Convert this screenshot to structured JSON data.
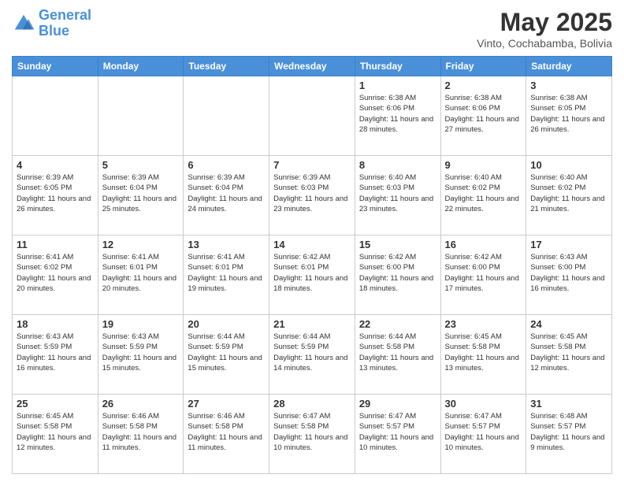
{
  "header": {
    "logo_line1": "General",
    "logo_line2": "Blue",
    "month_year": "May 2025",
    "location": "Vinto, Cochabamba, Bolivia"
  },
  "days_of_week": [
    "Sunday",
    "Monday",
    "Tuesday",
    "Wednesday",
    "Thursday",
    "Friday",
    "Saturday"
  ],
  "weeks": [
    [
      {
        "day": "",
        "sunrise": "",
        "sunset": "",
        "daylight": ""
      },
      {
        "day": "",
        "sunrise": "",
        "sunset": "",
        "daylight": ""
      },
      {
        "day": "",
        "sunrise": "",
        "sunset": "",
        "daylight": ""
      },
      {
        "day": "",
        "sunrise": "",
        "sunset": "",
        "daylight": ""
      },
      {
        "day": "1",
        "sunrise": "Sunrise: 6:38 AM",
        "sunset": "Sunset: 6:06 PM",
        "daylight": "Daylight: 11 hours and 28 minutes."
      },
      {
        "day": "2",
        "sunrise": "Sunrise: 6:38 AM",
        "sunset": "Sunset: 6:06 PM",
        "daylight": "Daylight: 11 hours and 27 minutes."
      },
      {
        "day": "3",
        "sunrise": "Sunrise: 6:38 AM",
        "sunset": "Sunset: 6:05 PM",
        "daylight": "Daylight: 11 hours and 26 minutes."
      }
    ],
    [
      {
        "day": "4",
        "sunrise": "Sunrise: 6:39 AM",
        "sunset": "Sunset: 6:05 PM",
        "daylight": "Daylight: 11 hours and 26 minutes."
      },
      {
        "day": "5",
        "sunrise": "Sunrise: 6:39 AM",
        "sunset": "Sunset: 6:04 PM",
        "daylight": "Daylight: 11 hours and 25 minutes."
      },
      {
        "day": "6",
        "sunrise": "Sunrise: 6:39 AM",
        "sunset": "Sunset: 6:04 PM",
        "daylight": "Daylight: 11 hours and 24 minutes."
      },
      {
        "day": "7",
        "sunrise": "Sunrise: 6:39 AM",
        "sunset": "Sunset: 6:03 PM",
        "daylight": "Daylight: 11 hours and 23 minutes."
      },
      {
        "day": "8",
        "sunrise": "Sunrise: 6:40 AM",
        "sunset": "Sunset: 6:03 PM",
        "daylight": "Daylight: 11 hours and 23 minutes."
      },
      {
        "day": "9",
        "sunrise": "Sunrise: 6:40 AM",
        "sunset": "Sunset: 6:02 PM",
        "daylight": "Daylight: 11 hours and 22 minutes."
      },
      {
        "day": "10",
        "sunrise": "Sunrise: 6:40 AM",
        "sunset": "Sunset: 6:02 PM",
        "daylight": "Daylight: 11 hours and 21 minutes."
      }
    ],
    [
      {
        "day": "11",
        "sunrise": "Sunrise: 6:41 AM",
        "sunset": "Sunset: 6:02 PM",
        "daylight": "Daylight: 11 hours and 20 minutes."
      },
      {
        "day": "12",
        "sunrise": "Sunrise: 6:41 AM",
        "sunset": "Sunset: 6:01 PM",
        "daylight": "Daylight: 11 hours and 20 minutes."
      },
      {
        "day": "13",
        "sunrise": "Sunrise: 6:41 AM",
        "sunset": "Sunset: 6:01 PM",
        "daylight": "Daylight: 11 hours and 19 minutes."
      },
      {
        "day": "14",
        "sunrise": "Sunrise: 6:42 AM",
        "sunset": "Sunset: 6:01 PM",
        "daylight": "Daylight: 11 hours and 18 minutes."
      },
      {
        "day": "15",
        "sunrise": "Sunrise: 6:42 AM",
        "sunset": "Sunset: 6:00 PM",
        "daylight": "Daylight: 11 hours and 18 minutes."
      },
      {
        "day": "16",
        "sunrise": "Sunrise: 6:42 AM",
        "sunset": "Sunset: 6:00 PM",
        "daylight": "Daylight: 11 hours and 17 minutes."
      },
      {
        "day": "17",
        "sunrise": "Sunrise: 6:43 AM",
        "sunset": "Sunset: 6:00 PM",
        "daylight": "Daylight: 11 hours and 16 minutes."
      }
    ],
    [
      {
        "day": "18",
        "sunrise": "Sunrise: 6:43 AM",
        "sunset": "Sunset: 5:59 PM",
        "daylight": "Daylight: 11 hours and 16 minutes."
      },
      {
        "day": "19",
        "sunrise": "Sunrise: 6:43 AM",
        "sunset": "Sunset: 5:59 PM",
        "daylight": "Daylight: 11 hours and 15 minutes."
      },
      {
        "day": "20",
        "sunrise": "Sunrise: 6:44 AM",
        "sunset": "Sunset: 5:59 PM",
        "daylight": "Daylight: 11 hours and 15 minutes."
      },
      {
        "day": "21",
        "sunrise": "Sunrise: 6:44 AM",
        "sunset": "Sunset: 5:59 PM",
        "daylight": "Daylight: 11 hours and 14 minutes."
      },
      {
        "day": "22",
        "sunrise": "Sunrise: 6:44 AM",
        "sunset": "Sunset: 5:58 PM",
        "daylight": "Daylight: 11 hours and 13 minutes."
      },
      {
        "day": "23",
        "sunrise": "Sunrise: 6:45 AM",
        "sunset": "Sunset: 5:58 PM",
        "daylight": "Daylight: 11 hours and 13 minutes."
      },
      {
        "day": "24",
        "sunrise": "Sunrise: 6:45 AM",
        "sunset": "Sunset: 5:58 PM",
        "daylight": "Daylight: 11 hours and 12 minutes."
      }
    ],
    [
      {
        "day": "25",
        "sunrise": "Sunrise: 6:45 AM",
        "sunset": "Sunset: 5:58 PM",
        "daylight": "Daylight: 11 hours and 12 minutes."
      },
      {
        "day": "26",
        "sunrise": "Sunrise: 6:46 AM",
        "sunset": "Sunset: 5:58 PM",
        "daylight": "Daylight: 11 hours and 11 minutes."
      },
      {
        "day": "27",
        "sunrise": "Sunrise: 6:46 AM",
        "sunset": "Sunset: 5:58 PM",
        "daylight": "Daylight: 11 hours and 11 minutes."
      },
      {
        "day": "28",
        "sunrise": "Sunrise: 6:47 AM",
        "sunset": "Sunset: 5:58 PM",
        "daylight": "Daylight: 11 hours and 10 minutes."
      },
      {
        "day": "29",
        "sunrise": "Sunrise: 6:47 AM",
        "sunset": "Sunset: 5:57 PM",
        "daylight": "Daylight: 11 hours and 10 minutes."
      },
      {
        "day": "30",
        "sunrise": "Sunrise: 6:47 AM",
        "sunset": "Sunset: 5:57 PM",
        "daylight": "Daylight: 11 hours and 10 minutes."
      },
      {
        "day": "31",
        "sunrise": "Sunrise: 6:48 AM",
        "sunset": "Sunset: 5:57 PM",
        "daylight": "Daylight: 11 hours and 9 minutes."
      }
    ]
  ]
}
